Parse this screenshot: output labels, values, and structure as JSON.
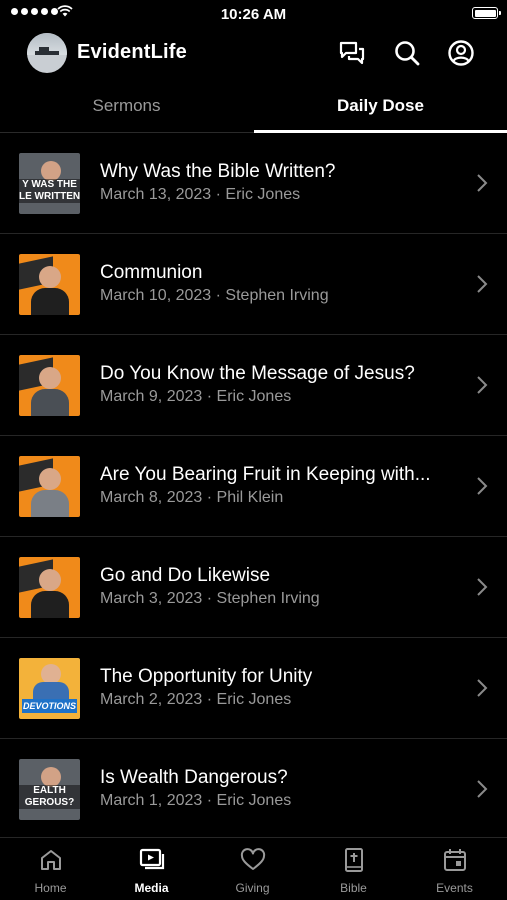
{
  "status": {
    "time": "10:26 AM"
  },
  "app": {
    "title": "EvidentLife"
  },
  "tabs": [
    {
      "label": "Sermons",
      "active": false
    },
    {
      "label": "Daily Dose",
      "active": true
    }
  ],
  "items": [
    {
      "title": "Why Was the Bible Written?",
      "date": "March 13, 2023",
      "speaker": "Eric Jones",
      "thumb_text": "Y WAS THE\nLE WRITTEN"
    },
    {
      "title": "Communion",
      "date": "March 10, 2023",
      "speaker": "Stephen Irving"
    },
    {
      "title": "Do You Know the Message of Jesus?",
      "date": "March 9, 2023",
      "speaker": "Eric Jones"
    },
    {
      "title": "Are You Bearing Fruit in Keeping with...",
      "date": "March 8, 2023",
      "speaker": "Phil Klein"
    },
    {
      "title": "Go and Do Likewise",
      "date": "March 3, 2023",
      "speaker": "Stephen Irving"
    },
    {
      "title": "The Opportunity for Unity",
      "date": "March 2, 2023",
      "speaker": "Eric Jones",
      "thumb_text": "DEVOTIONS"
    },
    {
      "title": "Is Wealth Dangerous?",
      "date": "March 1, 2023",
      "speaker": "Eric Jones",
      "thumb_text": "EALTH\nGEROUS?"
    }
  ],
  "tabbar": [
    {
      "label": "Home",
      "icon": "home-icon",
      "active": false
    },
    {
      "label": "Media",
      "icon": "media-icon",
      "active": true
    },
    {
      "label": "Giving",
      "icon": "heart-icon",
      "active": false
    },
    {
      "label": "Bible",
      "icon": "bible-icon",
      "active": false
    },
    {
      "label": "Events",
      "icon": "calendar-icon",
      "active": false
    }
  ],
  "separator": "·"
}
